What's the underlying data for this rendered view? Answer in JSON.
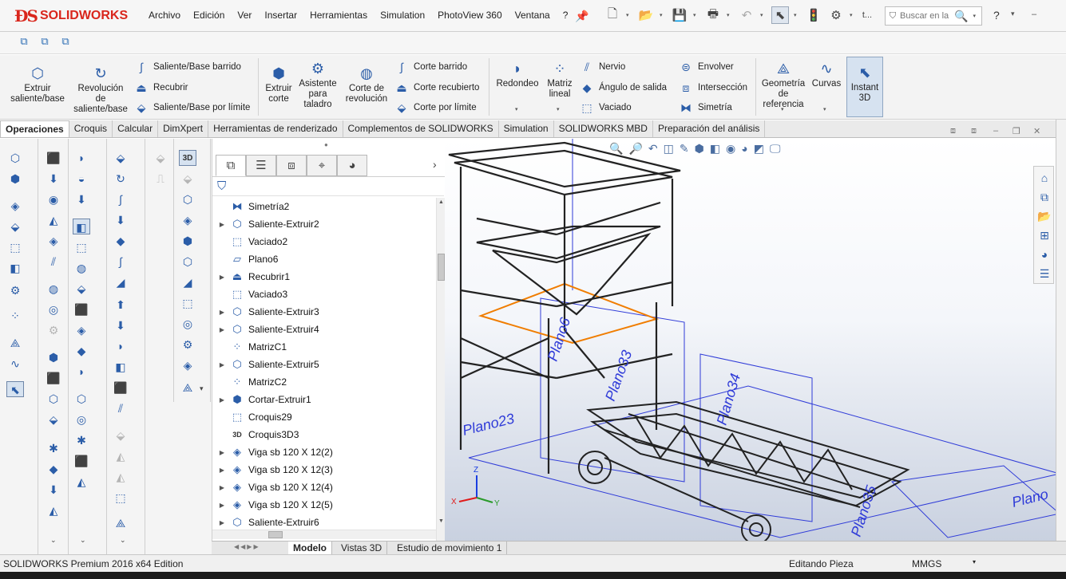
{
  "app": {
    "logo_text": "SOLIDWORKS",
    "menu": [
      "Archivo",
      "Edición",
      "Ver",
      "Insertar",
      "Herramientas",
      "Simulation",
      "PhotoView 360",
      "Ventana",
      "?"
    ],
    "tab_stub": "t...",
    "search_placeholder": "Buscar en la",
    "help_label": "?"
  },
  "ribbon": {
    "extrude_boss": "Extruir saliente/base",
    "revolve_boss": "Revolución de saliente/base",
    "swept_boss": "Saliente/Base barrido",
    "loft": "Recubrir",
    "boundary_boss": "Saliente/Base por límite",
    "extrude_cut": "Extruir corte",
    "hole_wizard": "Asistente para taladro",
    "revolve_cut": "Corte de revolución",
    "swept_cut": "Corte barrido",
    "lofted_cut": "Corte recubierto",
    "boundary_cut": "Corte por límite",
    "fillet": "Redondeo",
    "linear_pattern": "Matriz lineal",
    "rib": "Nervio",
    "draft": "Ángulo de salida",
    "shell": "Vaciado",
    "wrap": "Envolver",
    "intersect": "Intersección",
    "mirror": "Simetría",
    "ref_geometry": "Geometría de referencia",
    "curves": "Curvas",
    "instant3d": "Instant 3D"
  },
  "cm_tabs": [
    "Operaciones",
    "Croquis",
    "Calcular",
    "DimXpert",
    "Herramientas de renderizado",
    "Complementos de SOLIDWORKS",
    "Simulation",
    "SOLIDWORKS MBD",
    "Preparación del análisis"
  ],
  "feature_tree": [
    {
      "label": "Simetría2",
      "icon": "mirror-icon",
      "expandable": false
    },
    {
      "label": "Saliente-Extruir2",
      "icon": "extrude-icon",
      "expandable": true
    },
    {
      "label": "Vaciado2",
      "icon": "shell-icon",
      "expandable": false
    },
    {
      "label": "Plano6",
      "icon": "plane-icon",
      "expandable": false
    },
    {
      "label": "Recubrir1",
      "icon": "loft-icon",
      "expandable": true
    },
    {
      "label": "Vaciado3",
      "icon": "shell-icon",
      "expandable": false
    },
    {
      "label": "Saliente-Extruir3",
      "icon": "extrude-icon",
      "expandable": true
    },
    {
      "label": "Saliente-Extruir4",
      "icon": "extrude-icon",
      "expandable": true
    },
    {
      "label": "MatrizC1",
      "icon": "pattern-icon",
      "expandable": false
    },
    {
      "label": "Saliente-Extruir5",
      "icon": "extrude-icon",
      "expandable": true
    },
    {
      "label": "MatrizC2",
      "icon": "pattern-icon",
      "expandable": false
    },
    {
      "label": "Cortar-Extruir1",
      "icon": "cut-icon",
      "expandable": true
    },
    {
      "label": "Croquis29",
      "icon": "sketch-icon",
      "expandable": false
    },
    {
      "label": "Croquis3D3",
      "icon": "sketch3d-icon",
      "expandable": false
    },
    {
      "label": "Viga sb 120 X 12(2)",
      "icon": "part-icon",
      "expandable": true
    },
    {
      "label": "Viga sb 120 X 12(3)",
      "icon": "part-icon",
      "expandable": true
    },
    {
      "label": "Viga sb 120 X 12(4)",
      "icon": "part-icon",
      "expandable": true
    },
    {
      "label": "Viga sb 120 X 12(5)",
      "icon": "part-icon",
      "expandable": true
    },
    {
      "label": "Saliente-Extruir6",
      "icon": "extrude-icon",
      "expandable": true
    }
  ],
  "bottom_tabs": [
    "Modelo",
    "Vistas 3D",
    "Estudio de movimiento 1"
  ],
  "status": {
    "edition": "SOLIDWORKS Premium 2016 x64 Edition",
    "mode": "Editando Pieza",
    "units": "MMGS"
  },
  "viewport": {
    "plane_labels": [
      "Plano23",
      "Plano34",
      "Plano33",
      "Plano35",
      "Plano6",
      "Plano"
    ],
    "triad": {
      "x": "X",
      "y": "Y",
      "z": "Z"
    }
  }
}
